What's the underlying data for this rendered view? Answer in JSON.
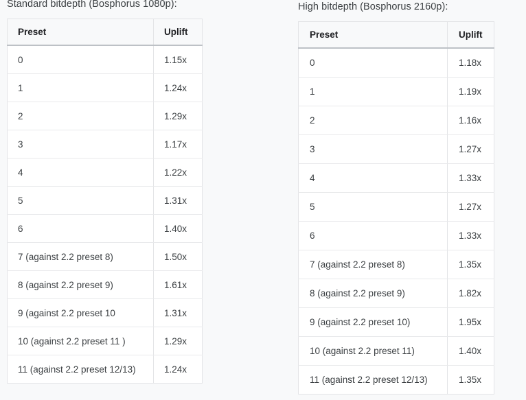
{
  "page": {
    "background_color": "#f8f9fa",
    "text_color": "#3c4043",
    "border_color": "#e3e4e6",
    "header_rule_color": "#bdc1c6"
  },
  "tables": [
    {
      "caption": "Standard bitdepth (Bosphorus 1080p):",
      "columns": [
        "Preset",
        "Uplift"
      ],
      "rows": [
        {
          "preset": "0",
          "uplift": "1.15x"
        },
        {
          "preset": "1",
          "uplift": "1.24x"
        },
        {
          "preset": "2",
          "uplift": "1.29x"
        },
        {
          "preset": "3",
          "uplift": "1.17x"
        },
        {
          "preset": "4",
          "uplift": "1.22x"
        },
        {
          "preset": "5",
          "uplift": "1.31x"
        },
        {
          "preset": "6",
          "uplift": "1.40x"
        },
        {
          "preset": "7 (against 2.2 preset 8)",
          "uplift": "1.50x"
        },
        {
          "preset": "8 (against 2.2 preset 9)",
          "uplift": "1.61x"
        },
        {
          "preset": "9 (against 2.2 preset 10",
          "uplift": "1.31x"
        },
        {
          "preset": "10 (against 2.2 preset 11 )",
          "uplift": "1.29x"
        },
        {
          "preset": "11 (against 2.2 preset 12/13)",
          "uplift": "1.24x"
        }
      ]
    },
    {
      "caption": "High bitdepth (Bosphorus 2160p):",
      "columns": [
        "Preset",
        "Uplift"
      ],
      "rows": [
        {
          "preset": "0",
          "uplift": "1.18x"
        },
        {
          "preset": "1",
          "uplift": "1.19x"
        },
        {
          "preset": "2",
          "uplift": "1.16x"
        },
        {
          "preset": "3",
          "uplift": "1.27x"
        },
        {
          "preset": "4",
          "uplift": "1.33x"
        },
        {
          "preset": "5",
          "uplift": "1.27x"
        },
        {
          "preset": "6",
          "uplift": "1.33x"
        },
        {
          "preset": "7 (against 2.2 preset 8)",
          "uplift": "1.35x"
        },
        {
          "preset": "8 (against 2.2 preset 9)",
          "uplift": "1.82x"
        },
        {
          "preset": "9 (against 2.2 preset 10)",
          "uplift": "1.95x"
        },
        {
          "preset": "10 (against 2.2 preset 11)",
          "uplift": "1.40x"
        },
        {
          "preset": "11 (against 2.2 preset 12/13)",
          "uplift": "1.35x"
        }
      ]
    }
  ]
}
